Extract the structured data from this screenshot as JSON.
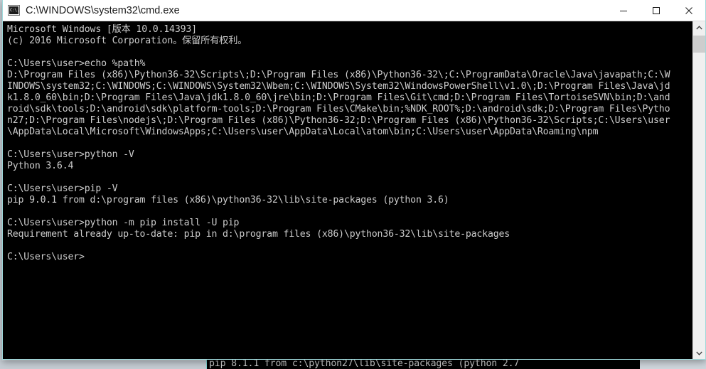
{
  "window": {
    "title": "C:\\WINDOWS\\system32\\cmd.exe",
    "icon": "cmd-icon",
    "icon_glyph": "C:\\.",
    "controls": {
      "minimize_label": "Minimize",
      "maximize_label": "Maximize",
      "close_label": "Close"
    }
  },
  "colors": {
    "titlebar_bg": "#ffffff",
    "titlebar_text": "#1a1a1a",
    "terminal_bg": "#000000",
    "terminal_text": "#cccccc",
    "window_border": "#9fd8da",
    "scrollbar_track": "#f0f0f0",
    "scrollbar_thumb": "#cdcdcd"
  },
  "terminal": {
    "lines": [
      "Microsoft Windows [版本 10.0.14393]",
      "(c) 2016 Microsoft Corporation。保留所有权利。",
      "",
      "C:\\Users\\user>echo %path%",
      "D:\\Program Files (x86)\\Python36-32\\Scripts\\;D:\\Program Files (x86)\\Python36-32\\;C:\\ProgramData\\Oracle\\Java\\javapath;C:\\W",
      "INDOWS\\system32;C:\\WINDOWS;C:\\WINDOWS\\System32\\Wbem;C:\\WINDOWS\\System32\\WindowsPowerShell\\v1.0\\;D:\\Program Files\\Java\\jd",
      "k1.8.0_60\\bin;D:\\Program Files\\Java\\jdk1.8.0_60\\jre\\bin;D:\\Program Files\\Git\\cmd;D:\\Program Files\\TortoiseSVN\\bin;D:\\and",
      "roid\\sdk\\tools;D:\\android\\sdk\\platform-tools;D:\\Program Files\\CMake\\bin;%NDK_ROOT%;D:\\android\\sdk;D:\\Program Files\\Pytho",
      "n27;D:\\Program Files\\nodejs\\;D:\\Program Files (x86)\\Python36-32;D:\\Program Files (x86)\\Python36-32\\Scripts;C:\\Users\\user",
      "\\AppData\\Local\\Microsoft\\WindowsApps;C:\\Users\\user\\AppData\\Local\\atom\\bin;C:\\Users\\user\\AppData\\Roaming\\npm",
      "",
      "C:\\Users\\user>python -V",
      "Python 3.6.4",
      "",
      "C:\\Users\\user>pip -V",
      "pip 9.0.1 from d:\\program files (x86)\\python36-32\\lib\\site-packages (python 3.6)",
      "",
      "C:\\Users\\user>python -m pip install -U pip",
      "Requirement already up-to-date: pip in d:\\program files (x86)\\python36-32\\lib\\site-packages",
      "",
      "C:\\Users\\user>"
    ]
  },
  "background_window": {
    "visible_line": "pip 8.1.1 from c:\\python27\\lib\\site-packages (python 2.7"
  },
  "scrollbar": {
    "up_arrow": "chevron-up-icon",
    "down_arrow": "chevron-down-icon"
  }
}
